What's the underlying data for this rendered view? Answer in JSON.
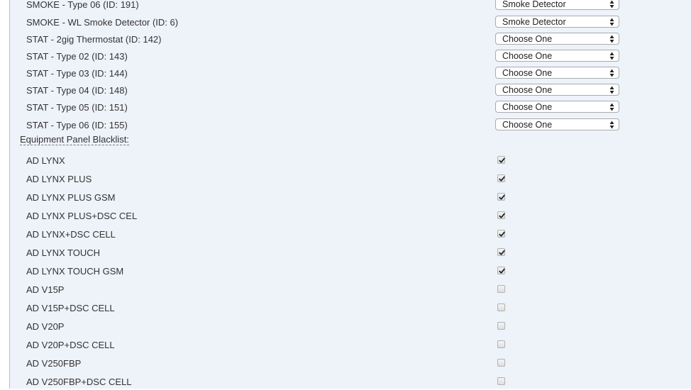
{
  "device_mappings": [
    {
      "label": "SMOKE - Type 06 (ID: 191)",
      "selected": "Smoke Detector"
    },
    {
      "label": "SMOKE - WL Smoke Detector (ID: 6)",
      "selected": "Smoke Detector"
    },
    {
      "label": "STAT - 2gig Thermostat (ID: 142)",
      "selected": "Choose One"
    },
    {
      "label": "STAT - Type 02 (ID: 143)",
      "selected": "Choose One"
    },
    {
      "label": "STAT - Type 03 (ID: 144)",
      "selected": "Choose One"
    },
    {
      "label": "STAT - Type 04 (ID: 148)",
      "selected": "Choose One"
    },
    {
      "label": "STAT - Type 05 (ID: 151)",
      "selected": "Choose One"
    },
    {
      "label": "STAT - Type 06 (ID: 155)",
      "selected": "Choose One"
    }
  ],
  "blacklist": {
    "title": "Equipment Panel Blacklist:",
    "items": [
      {
        "label": "AD LYNX",
        "checked": true
      },
      {
        "label": "AD LYNX PLUS",
        "checked": true
      },
      {
        "label": "AD LYNX PLUS GSM",
        "checked": true
      },
      {
        "label": "AD LYNX PLUS+DSC CEL",
        "checked": true
      },
      {
        "label": "AD LYNX+DSC CELL",
        "checked": true
      },
      {
        "label": "AD LYNX TOUCH",
        "checked": true
      },
      {
        "label": "AD LYNX TOUCH GSM",
        "checked": true
      },
      {
        "label": "AD V15P",
        "checked": false
      },
      {
        "label": "AD V15P+DSC CELL",
        "checked": false
      },
      {
        "label": "AD V20P",
        "checked": false
      },
      {
        "label": "AD V20P+DSC CELL",
        "checked": false
      },
      {
        "label": "AD V250FBP",
        "checked": false
      },
      {
        "label": "AD V250FBP+DSC CELL",
        "checked": false
      }
    ]
  }
}
